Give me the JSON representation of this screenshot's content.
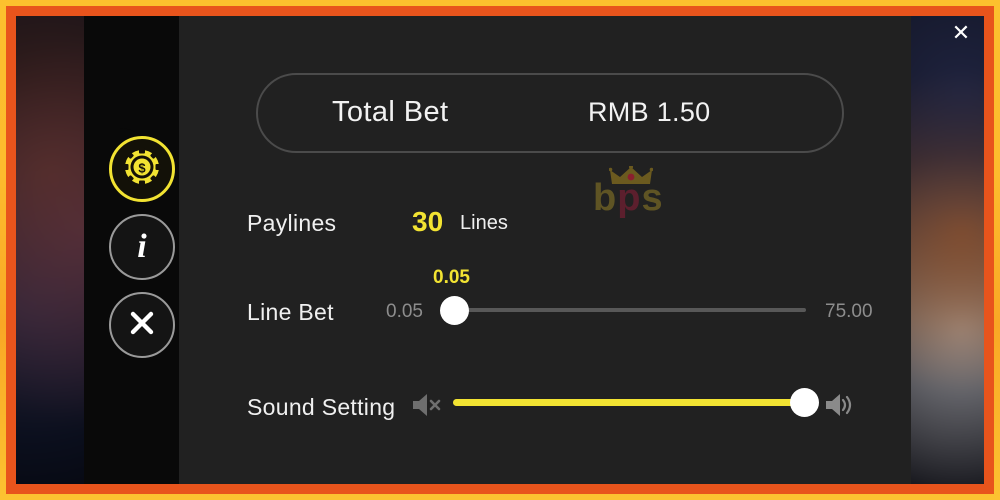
{
  "window": {
    "close_label": "✕"
  },
  "sidebar": {
    "items": [
      {
        "name": "bet-settings",
        "icon": "casino-chip-icon",
        "active": true
      },
      {
        "name": "info",
        "icon": "info-icon",
        "label": "i",
        "active": false
      },
      {
        "name": "close",
        "icon": "close-x-icon",
        "label": "✕",
        "active": false
      }
    ]
  },
  "total_bet": {
    "label": "Total Bet",
    "value": "RMB 1.50"
  },
  "watermark": {
    "crown": "♛",
    "letter_b": "b",
    "letter_p": "p",
    "letter_s": "s"
  },
  "paylines": {
    "label": "Paylines",
    "count": "30",
    "unit": "Lines"
  },
  "line_bet": {
    "label": "Line Bet",
    "current": "0.05",
    "min": "0.05",
    "max": "75.00",
    "percent": 0
  },
  "sound": {
    "label": "Sound Setting",
    "mute_icon": "speaker-mute-icon",
    "on_icon": "speaker-on-icon",
    "percent": 97
  },
  "colors": {
    "accent_yellow": "#f2e332",
    "panel_bg": "#212121",
    "rail_bg": "#090909",
    "frame_yellow": "#fcc02e",
    "frame_orange": "#e8541c",
    "text_primary": "#f0f0f0",
    "text_muted": "#8d8d8d"
  }
}
